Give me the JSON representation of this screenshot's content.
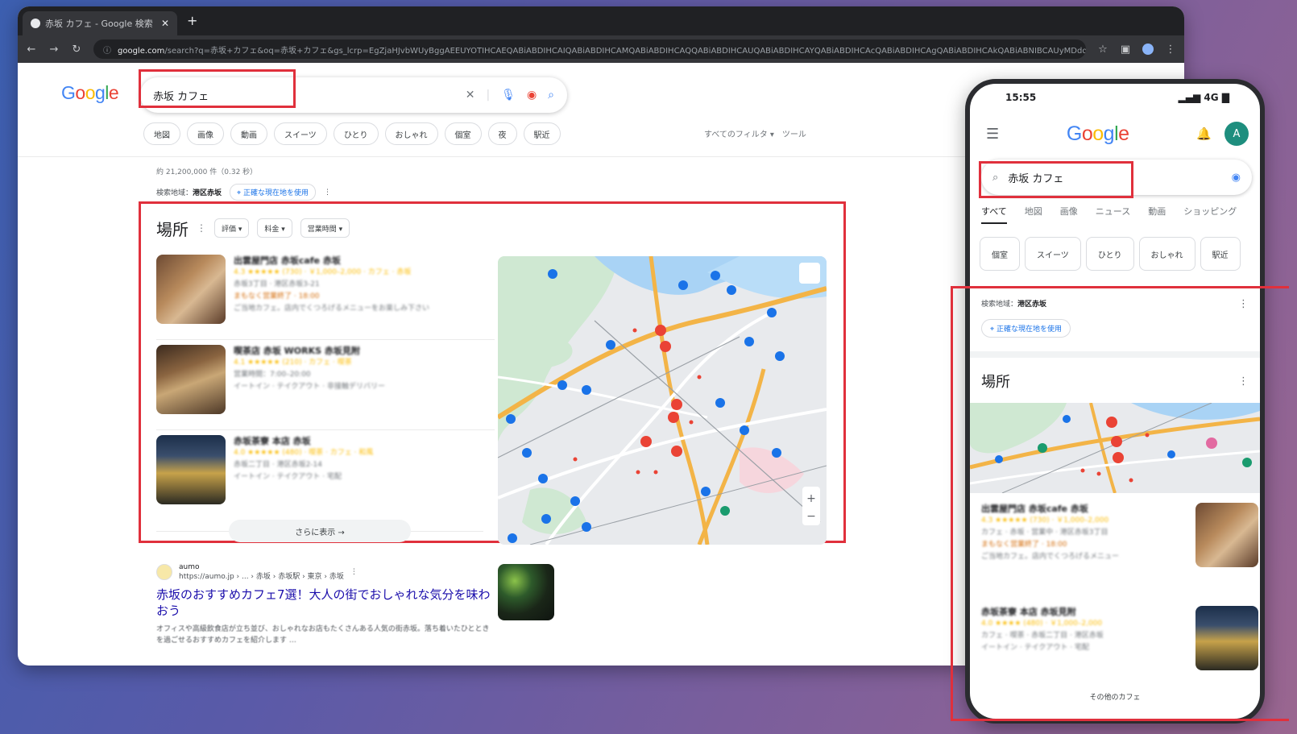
{
  "browser": {
    "tab_title": "赤坂 カフェ - Google 検索",
    "new_tab": "+",
    "url_host": "google.com",
    "url_rest": "/search?q=赤坂+カフェ&oq=赤坂+カフェ&gs_lcrp=EgZjaHJvbWUyBggAEEUYOTIHCAEQABiABDIHCAIQABiABDIHCAMQABiABDIHCAQQABiABDIHCAUQABiABDIHCAYQABiABDIHCAcQABiABDIHCAgQABiABDIHCAkQABiABNIBCAUyMDdqMGo3qAIAsAIA&sourceid=chrome&ie=UTF-8"
  },
  "google": {
    "query": "赤坂 カフェ",
    "chips": [
      "地図",
      "画像",
      "動画",
      "スイーツ",
      "ひとり",
      "おしゃれ",
      "個室",
      "夜",
      "駅近"
    ],
    "filters_right": [
      "すべてのフィルタ ▾",
      "ツール"
    ],
    "results_count": "約 21,200,000 件（0.32 秒）",
    "location": {
      "label": "検索地域：",
      "value": "港区赤坂",
      "button": "正確な現在地を使用"
    },
    "places": {
      "title": "場所",
      "filters": [
        "評価 ▾",
        "料金 ▾",
        "営業時間 ▾"
      ],
      "items": [
        {
          "name": "出雲屋門店 赤坂cafe 赤坂",
          "meta": "4.3 ★★★★★ (730) · ￥1,000–2,000 · カフェ · 赤坂",
          "addr": "赤坂3丁目 · 港区赤坂3-21",
          "status": "まもなく営業終了 · 18:00",
          "desc": "ご当地カフェ。店内でくつろげるメニューをお楽しみ下さい"
        },
        {
          "name": "喫茶店 赤坂 WORKS 赤坂見附",
          "meta": "4.1 ★★★★★ (210) · カフェ · 喫茶",
          "addr": "営業時間：7:00–20:00",
          "status": "",
          "desc": "イートイン · テイクアウト · 非接触デリバリー"
        },
        {
          "name": "赤坂茶寮 本店 赤坂",
          "meta": "4.0 ★★★★★ (480) · 喫茶 · カフェ · 和風",
          "addr": "赤坂二丁目 · 港区赤坂2-14",
          "status": "",
          "desc": "イートイン · テイクアウト · 宅配"
        }
      ],
      "more_button": "さらに表示 →"
    },
    "web_result": {
      "site": "aumo",
      "breadcrumb": "https://aumo.jp › ... › 赤坂 › 赤坂駅 › 東京 › 赤坂",
      "title": "赤坂のおすすめカフェ7選！大人の街でおしゃれな気分を味わおう",
      "snippet": "オフィスや高級飲食店が立ち並び、おしゃれなお店もたくさんある人気の街赤坂。落ち着いたひとときを過ごせるおすすめカフェを紹介します …"
    }
  },
  "phone": {
    "time": "15:55",
    "status_icons": "▂▄▆ 4G ▇",
    "avatar_letter": "A",
    "query": "赤坂 カフェ",
    "tabs": [
      "すべて",
      "地図",
      "画像",
      "ニュース",
      "動画",
      "ショッピング"
    ],
    "chips": [
      "個室",
      "スイーツ",
      "ひとり",
      "おしゃれ",
      "駅近"
    ],
    "location": {
      "label": "検索地域：",
      "value": "港区赤坂",
      "button": "正確な現在地を使用"
    },
    "places_title": "場所",
    "items": [
      {
        "name": "出雲屋門店 赤坂cafe 赤坂",
        "meta": "4.3 ★★★★★ (730) · ￥1,000–2,000",
        "line2": "カフェ · 赤坂 · 営業中 · 港区赤坂3丁目",
        "status": "まもなく営業終了 · 18:00",
        "desc": "ご当地カフェ。店内でくつろげるメニュー"
      },
      {
        "name": "赤坂茶寮 本店 赤坂見附",
        "meta": "4.0 ★★★★ (480) · ￥1,000–2,000",
        "line2": "カフェ · 喫茶 · 赤坂二丁目 · 港区赤坂",
        "status": "",
        "desc": "イートイン · テイクアウト · 宅配"
      }
    ],
    "more": "その他のカフェ"
  },
  "colors": {
    "highlight": "#e0303c",
    "link": "#1a0dab",
    "accent": "#1a73e8"
  }
}
